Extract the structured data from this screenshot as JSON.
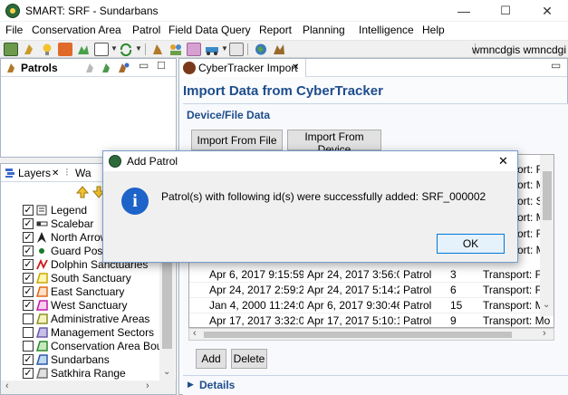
{
  "window": {
    "title": "SMART: SRF - Sundarbans",
    "minimize": "—",
    "maximize": "☐",
    "close": "✕"
  },
  "menu": [
    "File",
    "Conservation Area",
    "Patrol",
    "Field Data",
    "Query",
    "Report",
    "Planning",
    "Intelligence",
    "Help"
  ],
  "toolbar": {
    "user": "wmncdgis wmncdgi"
  },
  "patrols_panel": {
    "title": "Patrols"
  },
  "layers_panel": {
    "tab_layers": "Layers",
    "tab_close": "✕",
    "tab_way": "Wa",
    "items": [
      {
        "label": "Legend",
        "checked": true
      },
      {
        "label": "Scalebar",
        "checked": true
      },
      {
        "label": "North Arrow",
        "checked": true
      },
      {
        "label": "Guard Post",
        "checked": true
      },
      {
        "label": "Dolphin Sanctuaries",
        "checked": true
      },
      {
        "label": "South Sanctuary",
        "checked": true
      },
      {
        "label": "East Sanctuary",
        "checked": true
      },
      {
        "label": "West Sanctuary",
        "checked": true
      },
      {
        "label": "Administrative Areas",
        "checked": false
      },
      {
        "label": "Management Sectors",
        "checked": false
      },
      {
        "label": "Conservation Area Bound",
        "checked": false
      },
      {
        "label": "Sundarbans",
        "checked": true
      },
      {
        "label": "Satkhira Range",
        "checked": true
      }
    ]
  },
  "editor": {
    "tab_title": "CyberTracker Import",
    "tab_close": "✕",
    "heading": "Import Data from CyberTracker",
    "section_title": "Device/File Data",
    "import_file_button": "Import From File",
    "import_device_button": "Import From Device",
    "add_button": "Add",
    "delete_button": "Delete",
    "details_label": "Details"
  },
  "table": {
    "rows": [
      {
        "start": "Apr 6, 2017 9:15:59...",
        "end": "Apr 24, 2017 3:56:0...",
        "type": "Patrol",
        "count": "3",
        "transport": "Transport: Fibr"
      },
      {
        "start": "Apr 24, 2017 2:59:2...",
        "end": "Apr 24, 2017 5:14:2...",
        "type": "Patrol",
        "count": "6",
        "transport": "Transport: Fibr"
      },
      {
        "start": "Jan 4, 2000 11:24:0...",
        "end": "Apr 6, 2017 9:30:46...",
        "type": "Patrol",
        "count": "15",
        "transport": "Transport: Mo"
      },
      {
        "start": "Apr 17, 2017 3:32:0...",
        "end": "Apr 17, 2017 5:10:1...",
        "type": "Patrol",
        "count": "9",
        "transport": "Transport: Mo"
      }
    ],
    "partial_right_column": [
      "ort: Fibr",
      "ort: Mo",
      "ort: Spe",
      "ort: Mo",
      "ort: Fibr",
      "ort: Mo"
    ]
  },
  "dialog": {
    "title": "Add Patrol",
    "close": "✕",
    "message": "Patrol(s) with following id(s) were successfully added: SRF_000002",
    "ok": "OK",
    "icon": "info-icon"
  }
}
